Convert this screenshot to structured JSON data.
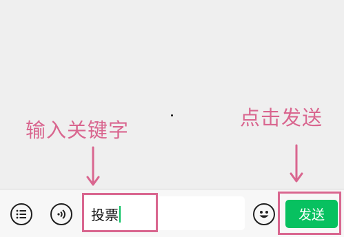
{
  "annotations": {
    "input_hint": "输入关键字",
    "send_hint": "点击发送"
  },
  "input": {
    "value": "投票"
  },
  "toolbar": {
    "send_label": "发送",
    "left_icons": [
      "list-menu-icon",
      "voice-icon"
    ],
    "right_icons": [
      "emoji-icon"
    ]
  },
  "colors": {
    "annotation": "#d9668f",
    "send_button": "#07c160",
    "caret": "#07c160",
    "chat_background": "#efefef"
  }
}
